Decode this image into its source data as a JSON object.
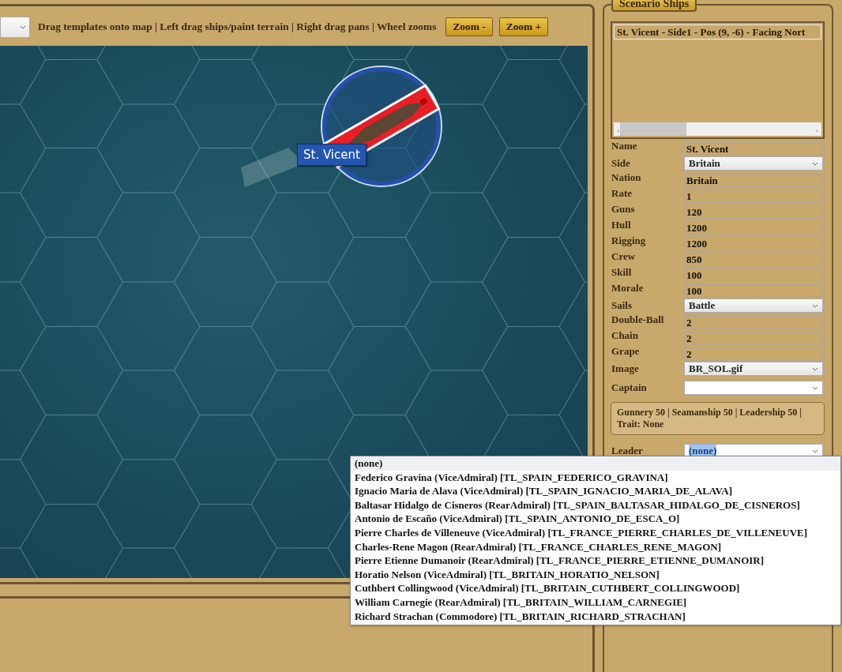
{
  "toolbar": {
    "hint": "Drag templates onto map | Left drag ships/paint terrain | Right drag pans | Wheel zooms",
    "buttons": [
      "Zoom -",
      "Zoom +"
    ]
  },
  "map": {
    "ships": [
      {
        "label": "St. Vicent"
      }
    ]
  },
  "ships_panel": {
    "title": "Scenario Ships",
    "ships": [
      {
        "label": "St. Vicent - Side1 - Pos (9, -6) - Facing Nort",
        "selected": true
      }
    ],
    "scroll_arrows": [
      "‹",
      "›"
    ],
    "fields": [
      {
        "kind": "text",
        "label": "Name",
        "value": "St. Vicent"
      },
      {
        "kind": "select",
        "label": "Side",
        "value": "Britain"
      },
      {
        "kind": "text",
        "label": "Nation",
        "value": "Britain"
      },
      {
        "kind": "text",
        "label": "Rate",
        "value": "1"
      },
      {
        "kind": "text",
        "label": "Guns",
        "value": "120"
      },
      {
        "kind": "text",
        "label": "Hull",
        "value": "1200"
      },
      {
        "kind": "text",
        "label": "Rigging",
        "value": "1200"
      },
      {
        "kind": "text",
        "label": "Crew",
        "value": "850"
      },
      {
        "kind": "text",
        "label": "Skill",
        "value": "100"
      },
      {
        "kind": "text",
        "label": "Morale",
        "value": "100"
      },
      {
        "kind": "select",
        "label": "Sails",
        "value": "Battle"
      },
      {
        "kind": "text",
        "label": "Double-Ball",
        "value": "2"
      },
      {
        "kind": "text",
        "label": "Chain",
        "value": "2"
      },
      {
        "kind": "text",
        "label": "Grape",
        "value": "2"
      },
      {
        "kind": "select",
        "label": "Image",
        "value": "BR_SOL.gif"
      },
      {
        "kind": "select",
        "label": "Captain",
        "white": true
      },
      {
        "kind": "info",
        "text": "Gunnery 50 | Seamanship 50 | Leadership 50 | Trait: None"
      },
      {
        "kind": "select",
        "label": "Leader",
        "value": "(none)",
        "white": true,
        "open": true
      }
    ]
  },
  "leader_dropdown": {
    "options": [
      {
        "label": "(none)",
        "selected": true
      },
      {
        "label": "Federico Gravina (ViceAdmiral) [TL_SPAIN_FEDERICO_GRAVINA]",
        "selected": false
      },
      {
        "label": "Ignacio Maria de Alava (ViceAdmiral) [TL_SPAIN_IGNACIO_MARIA_DE_ALAVA]",
        "selected": false
      },
      {
        "label": "Baltasar Hidalgo de Cisneros (RearAdmiral) [TL_SPAIN_BALTASAR_HIDALGO_DE_CISNEROS]",
        "selected": false
      },
      {
        "label": "Antonio de Escaño (ViceAdmiral) [TL_SPAIN_ANTONIO_DE_ESCA_O]",
        "selected": false
      },
      {
        "label": "Pierre Charles de Villeneuve (ViceAdmiral) [TL_FRANCE_PIERRE_CHARLES_DE_VILLENEUVE]",
        "selected": false
      },
      {
        "label": "Charles-Rene Magon (RearAdmiral) [TL_FRANCE_CHARLES_RENE_MAGON]",
        "selected": false
      },
      {
        "label": "Pierre Etienne Dumanoir (RearAdmiral) [TL_FRANCE_PIERRE_ETIENNE_DUMANOIR]",
        "selected": false
      },
      {
        "label": "Horatio Nelson (ViceAdmiral) [TL_BRITAIN_HORATIO_NELSON]",
        "selected": false
      },
      {
        "label": "Cuthbert Collingwood (ViceAdmiral) [TL_BRITAIN_CUTHBERT_COLLINGWOOD]",
        "selected": false
      },
      {
        "label": "William Carnegie (RearAdmiral) [TL_BRITAIN_WILLIAM_CARNEGIE]",
        "selected": false
      },
      {
        "label": "Richard Strachan (Commodore) [TL_BRITAIN_RICHARD_STRACHAN]",
        "selected": false
      }
    ]
  }
}
